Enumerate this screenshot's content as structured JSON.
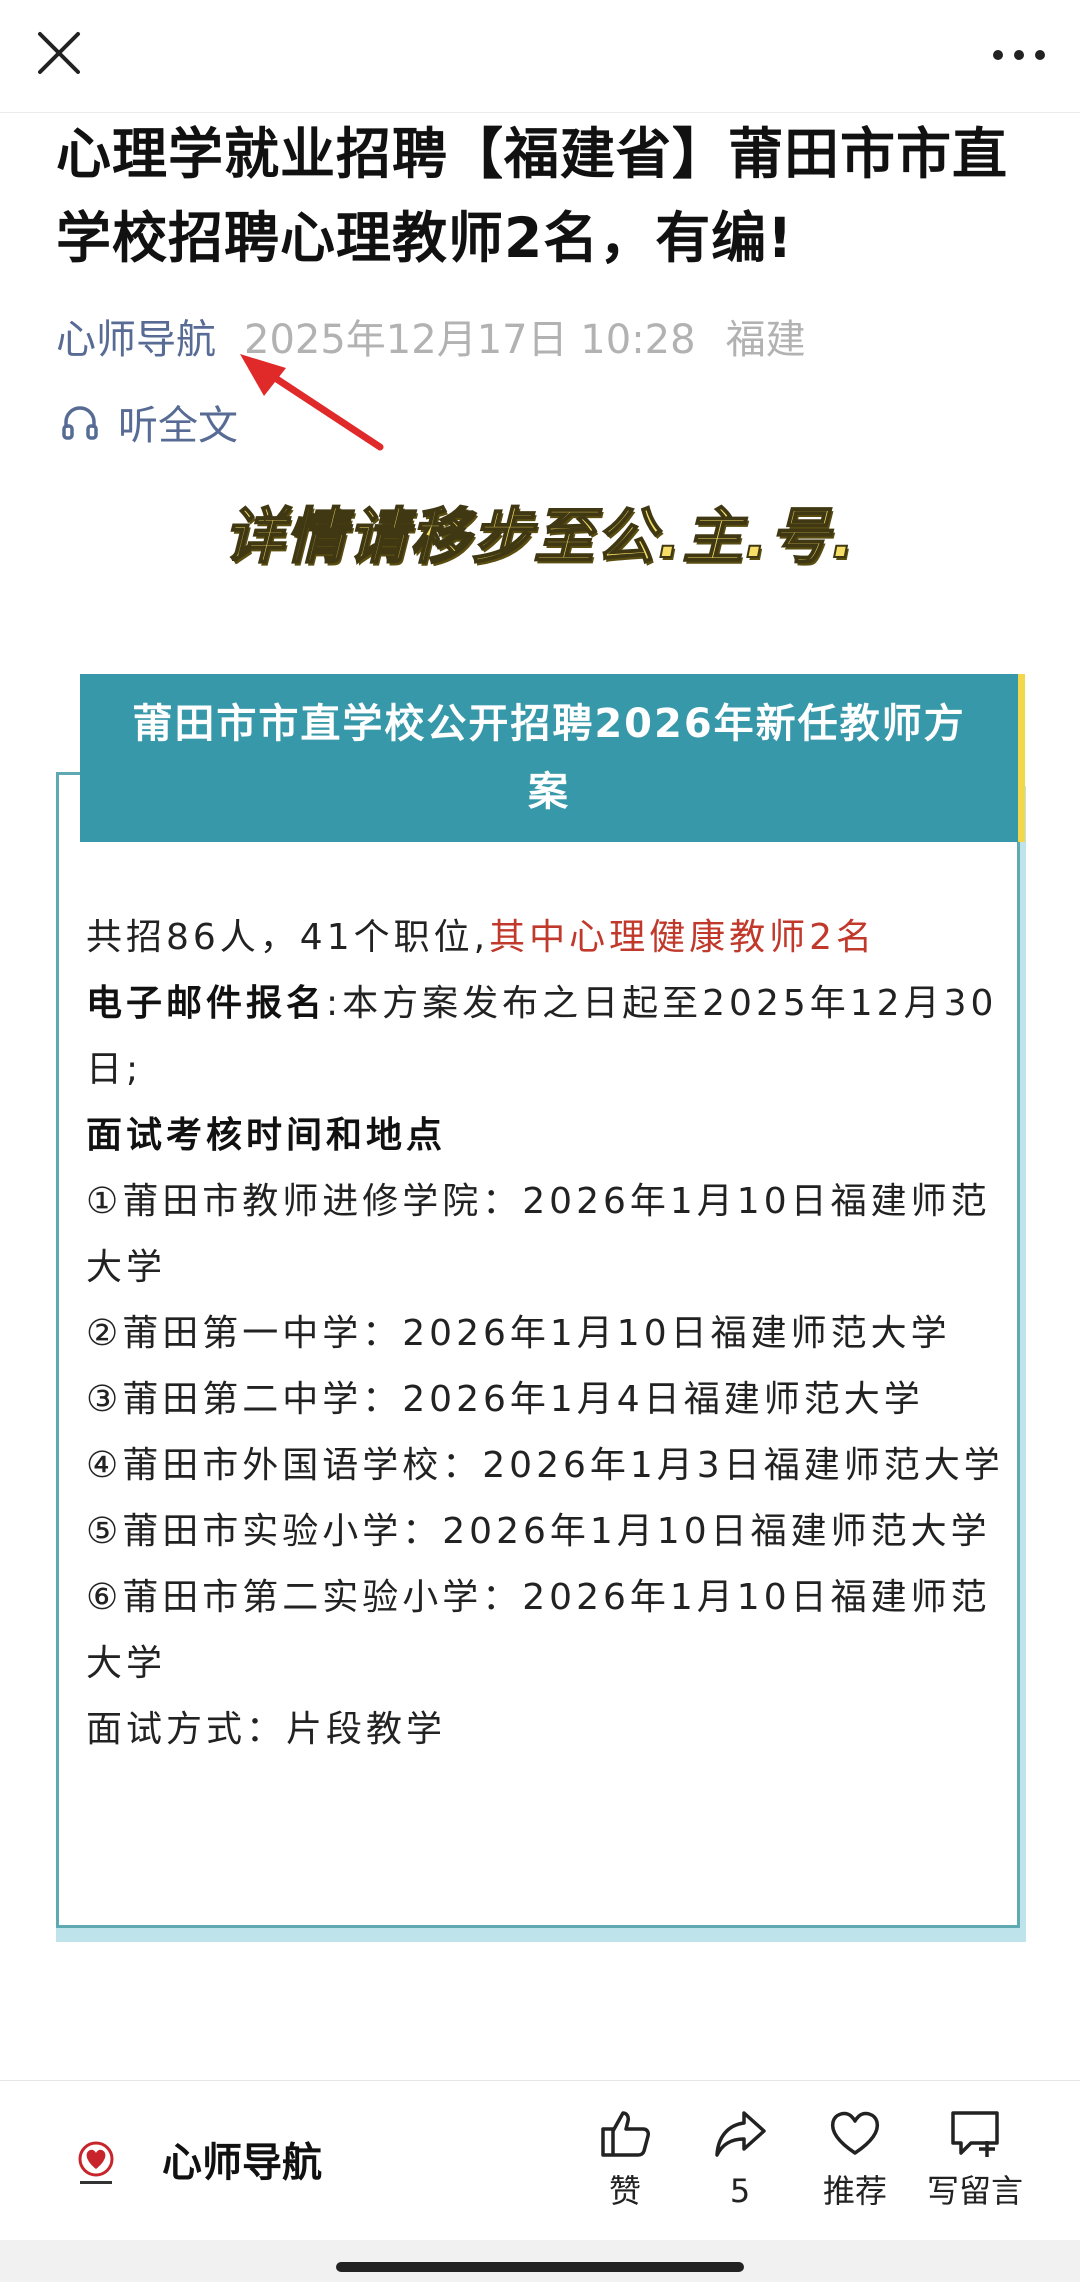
{
  "article": {
    "title": "心理学就业招聘【福建省】莆田市市直学校招聘心理教师2名，有编!",
    "author": "心师导航",
    "date": "2025年12月17日 10:28",
    "location": "福建",
    "listen_label": "听全文",
    "promo_text": "详情请移步至公.主.号."
  },
  "card": {
    "header": "莆田市市直学校公开招聘2026年新任教师方案",
    "lines": {
      "l1_plain": "共招86人，41个职位,",
      "l1_red": "其中心理健康教师2名",
      "l2_bold": "电子邮件报名",
      "l2_plain": ":本方案发布之日起至2025年12月30日;",
      "l3_bold": "面试考核时间和地点",
      "l4": "①莆田市教师进修学院：2026年1月10日福建师范大学",
      "l5": "②莆田第一中学：2026年1月10日福建师范大学",
      "l6": "③莆田第二中学：2026年1月4日福建师范大学",
      "l7": "④莆田市外国语学校：2026年1月3日福建师范大学",
      "l8": "⑤莆田市实验小学：2026年1月10日福建师范大学",
      "l9": "⑥莆田市第二实验小学：2026年1月10日福建师范大学",
      "l10": "面试方式：片段教学"
    }
  },
  "bottom": {
    "account_name": "心师导航",
    "like_label": "赞",
    "share_count": "5",
    "recommend_label": "推荐",
    "comment_label": "写留言"
  },
  "colors": {
    "link": "#576b95",
    "card_header": "#3798a9",
    "accent_red": "#c0392b",
    "promo": "#f7df67",
    "arrow": "#e02a2a"
  },
  "icons": [
    "close-icon",
    "more-icon",
    "headphones-icon",
    "arrow-annotation",
    "thumbs-up-icon",
    "share-icon",
    "heart-icon",
    "comment-icon",
    "account-logo"
  ]
}
